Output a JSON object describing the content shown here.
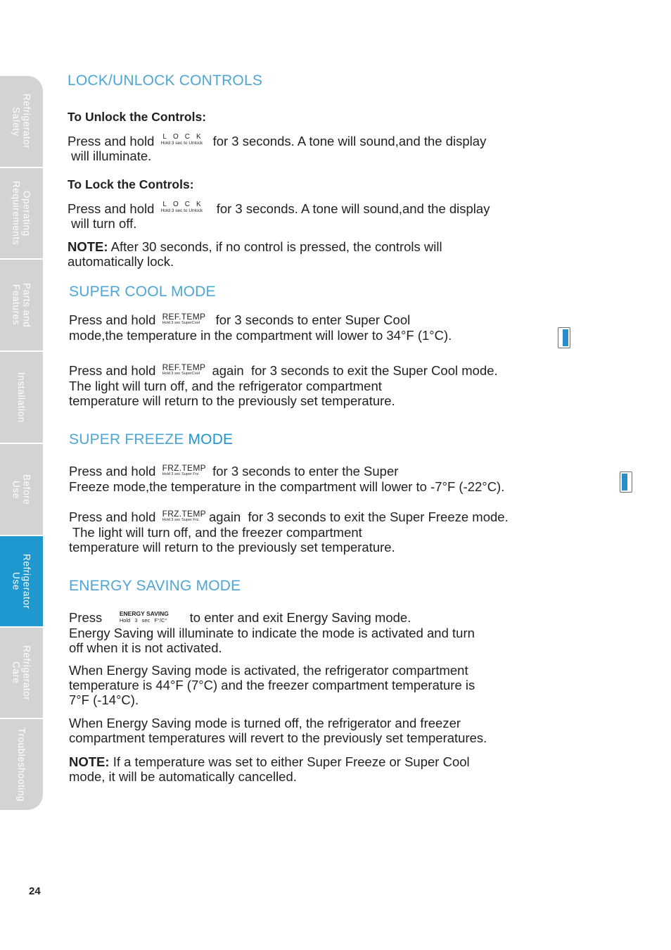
{
  "sidebar": {
    "tabs": [
      {
        "label": "Refrigerator\nSafety",
        "active": false
      },
      {
        "label": "Operating\nRequirements",
        "active": false
      },
      {
        "label": "Parts and\nFeatures",
        "active": false
      },
      {
        "label": "Installation",
        "active": false
      },
      {
        "label": "Before\nUse",
        "active": false
      },
      {
        "label": "Refrigerator\nUse",
        "active": true
      },
      {
        "label": "Refrigerator\nCare",
        "active": false
      },
      {
        "label": "Troubleshooting",
        "active": false
      }
    ]
  },
  "colors": {
    "heading": "#4da6d6",
    "heading_strong": "#2094cf",
    "active_tab": "#1f97cf",
    "inactive_tab": "#d1d3d4",
    "indicator_fill": "#2b8ec9"
  },
  "keys": {
    "lock": {
      "top": "LOCK",
      "bottom": "Hold 3 sec to Unlock"
    },
    "ref_temp": {
      "top": "REF.TEMP",
      "bottom": "Hold 3 sec SuperCool"
    },
    "frz_temp": {
      "top": "FRZ.TEMP",
      "bottom": "Hold 3 sec Super Frz."
    },
    "energy_saving": {
      "top": "ENERGY SAVING",
      "bottom": "Hold 3 sec F°/C°"
    }
  },
  "lock": {
    "heading": "LOCK/UNLOCK CONTROLS",
    "unlock_title": "To Unlock the Controls:",
    "unlock_pre": "Press and hold",
    "unlock_post": "for 3 seconds. A tone will sound,and the display",
    "unlock_line2": " will illuminate.",
    "lock_title": "To Lock the Controls:",
    "lock_pre": "Press and hold",
    "lock_post": "for 3 seconds. A tone will sound,and the display",
    "lock_line2": " will turn off.",
    "note_label": "NOTE:",
    "note_text": " After 30 seconds, if no control is pressed, the controls will",
    "note_line2": "automatically lock."
  },
  "super_cool": {
    "heading": "SUPER COOL MODE",
    "enter_pre": "Press and hold",
    "enter_post": "  for 3 seconds to enter Super Cool",
    "enter_line2": "mode,the temperature in the compartment will lower to 34°F (1°C).",
    "exit_pre": "Press and hold",
    "exit_post": "again  for 3 seconds to exit the Super Cool mode.",
    "exit_line2": "The light will turn off, and the refrigerator compartment",
    "exit_line3": "temperature will return to the previously set temperature."
  },
  "super_freeze": {
    "heading_a": "SUPER FREEZE ",
    "heading_b": "MODE",
    "enter_pre": "Press and hold",
    "enter_post": "for 3 seconds to enter the Super",
    "enter_line2": "Freeze mode,the temperature in the compartment will lower to -7°F (-22°C).",
    "exit_pre": "Press and hold",
    "exit_post": "again  for 3 seconds to exit the Super Freeze mode.",
    "exit_line2": " The light will turn off, and the freezer compartment",
    "exit_line3": "temperature will return to the previously set temperature."
  },
  "energy": {
    "heading": "ENERGY SAVING MODE",
    "press_pre": "Press",
    "press_post": "to enter and exit Energy Saving mode.",
    "line2": "Energy Saving will illuminate to indicate the mode is activated and turn",
    "line3": "off when it is not activated.",
    "p2_l1": "When Energy Saving mode is activated, the refrigerator compartment",
    "p2_l2": "temperature is 44°F (7°C) and the freezer compartment temperature is",
    "p2_l3": "7°F (-14°C).",
    "p3_l1": "When Energy Saving mode is turned off, the refrigerator and freezer",
    "p3_l2": "compartment temperatures will revert to the previously set temperatures.",
    "note_label": "NOTE:",
    "note_l1": " If a temperature was set to either Super Freeze or Super Cool",
    "note_l2": "mode, it will be automatically cancelled."
  },
  "page_number": "24"
}
